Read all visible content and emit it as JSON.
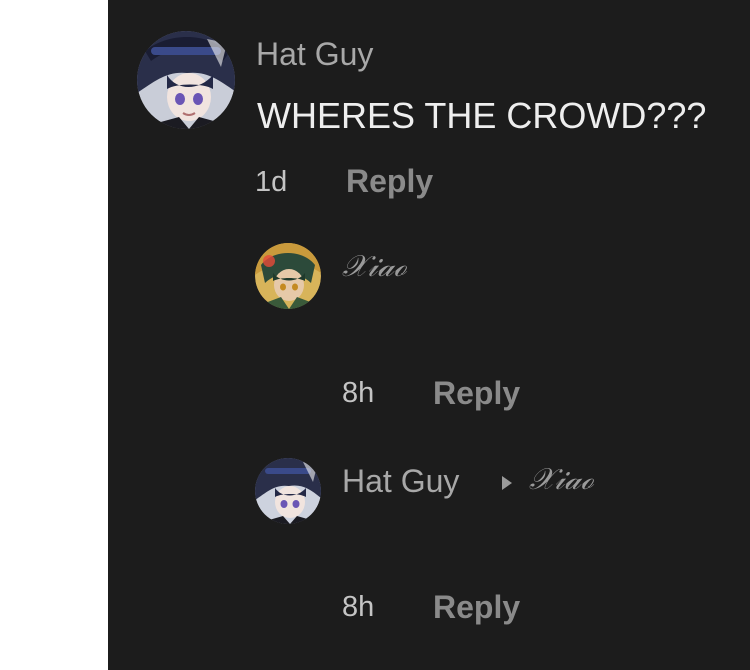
{
  "comments": {
    "top": {
      "author": "Hat Guy",
      "text": "WHERES THE CROWD???",
      "time": "1d",
      "reply_label": "Reply",
      "avatar_icon": "dark-haired-character-avatar"
    },
    "replies": [
      {
        "author": "𝒳𝒾𝒶ℴ",
        "text": "",
        "time": "8h",
        "reply_label": "Reply",
        "avatar_icon": "green-haired-character-avatar"
      },
      {
        "author": "Hat Guy",
        "reply_to": "𝒳𝒾𝒶ℴ",
        "text": "",
        "time": "8h",
        "reply_label": "Reply",
        "avatar_icon": "dark-haired-character-avatar",
        "reply_arrow_icon": "triangle-right-icon"
      }
    ]
  },
  "colors": {
    "background": "#1c1c1c",
    "username": "#a8a8a8",
    "comment_text": "#eeeeee",
    "reply_button": "#8a8a8a"
  }
}
